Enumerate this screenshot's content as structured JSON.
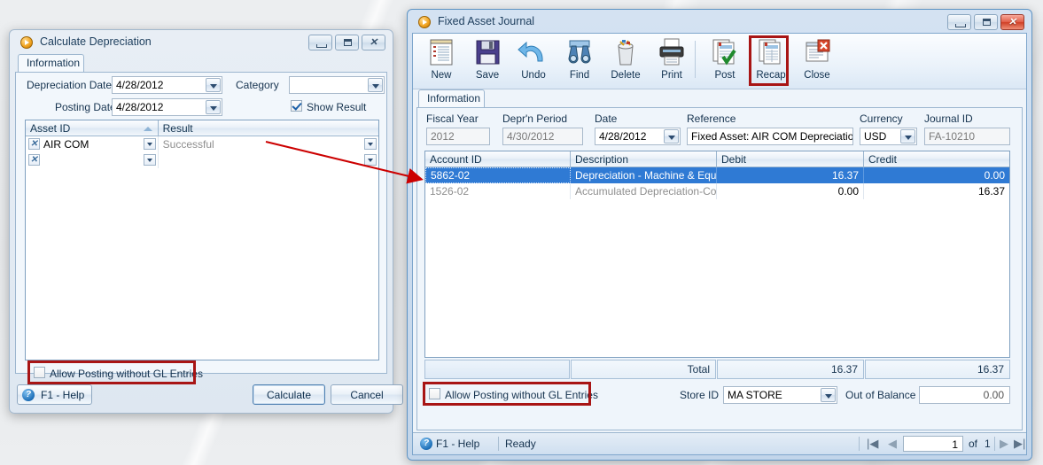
{
  "desktop": {
    "bg": "#e9eaec"
  },
  "annotation": {
    "color": "#cc0000",
    "highlight_color": "#a81515"
  },
  "left_window": {
    "title": "Calculate Depreciation",
    "icon": "app-orb-icon",
    "titlebar_buttons": [
      {
        "name": "minimize",
        "glyph": "minimize-icon"
      },
      {
        "name": "maximize",
        "glyph": "maximize-icon"
      },
      {
        "name": "close",
        "glyph": "close-icon"
      }
    ],
    "tab": {
      "label": "Information"
    },
    "fields": {
      "depreciation_date_label": "Depreciation Date",
      "depreciation_date_value": "4/28/2012",
      "posting_date_label": "Posting Date",
      "posting_date_value": "4/28/2012",
      "category_label": "Category",
      "category_value": "",
      "show_result_label": "Show Result",
      "show_result_checked": true
    },
    "grid": {
      "columns": [
        "Asset ID",
        "Result"
      ],
      "sorted_column": "Asset ID",
      "sort_direction": "asc",
      "rows": [
        {
          "asset_id": "AIR COM",
          "result": "Successful"
        },
        {
          "asset_id": "",
          "result": ""
        }
      ]
    },
    "allow_posting": {
      "label": "Allow Posting without GL Entries",
      "checked": false,
      "highlighted": true
    },
    "footer": {
      "help_label": "F1 - Help",
      "calculate_label": "Calculate",
      "calculate_accel": "C",
      "cancel_label": "Cancel"
    }
  },
  "right_window": {
    "title": "Fixed Asset Journal",
    "icon": "app-orb-icon",
    "titlebar_buttons": [
      {
        "name": "minimize",
        "glyph": "minimize-icon"
      },
      {
        "name": "maximize",
        "glyph": "maximize-icon"
      },
      {
        "name": "close",
        "glyph": "close-icon",
        "active": true
      }
    ],
    "toolbar": [
      {
        "label": "New",
        "icon": "new-document-icon"
      },
      {
        "label": "Save",
        "icon": "floppy-disk-icon"
      },
      {
        "label": "Undo",
        "icon": "undo-arrow-icon"
      },
      {
        "label": "Find",
        "icon": "binoculars-icon"
      },
      {
        "label": "Delete",
        "icon": "trash-can-icon"
      },
      {
        "label": "Print",
        "icon": "printer-icon"
      },
      {
        "label": "Post",
        "icon": "pages-check-icon"
      },
      {
        "label": "Recap",
        "icon": "pages-icon",
        "highlighted": true
      },
      {
        "label": "Close",
        "icon": "window-close-icon"
      }
    ],
    "tab": {
      "label": "Information"
    },
    "fields": {
      "fiscal_year_label": "Fiscal Year",
      "fiscal_year_value": "2012",
      "depr_period_label": "Depr'n Period",
      "depr_period_value": "4/30/2012",
      "date_label": "Date",
      "date_value": "4/28/2012",
      "reference_label": "Reference",
      "reference_value": "Fixed Asset: AIR COM Depreciation",
      "currency_label": "Currency",
      "currency_value": "USD",
      "journal_id_label": "Journal ID",
      "journal_id_value": "FA-10210"
    },
    "grid": {
      "columns": [
        "Account ID",
        "Description",
        "Debit",
        "Credit"
      ],
      "rows": [
        {
          "account_id": "5862-02",
          "description": "Depreciation - Machine & Equi...",
          "debit": "16.37",
          "credit": "0.00",
          "selected": true
        },
        {
          "account_id": "1526-02",
          "description": "Accumulated Depreciation-Cor...",
          "debit": "0.00",
          "credit": "16.37",
          "selected": false
        }
      ],
      "total_label": "Total",
      "total_debit": "16.37",
      "total_credit": "16.37"
    },
    "allow_posting": {
      "label": "Allow Posting without GL Entries",
      "checked": false,
      "highlighted": true
    },
    "bottom": {
      "store_id_label": "Store ID",
      "store_id_value": "MA STORE",
      "out_of_balance_label": "Out of Balance",
      "out_of_balance_value": "0.00"
    },
    "statusbar": {
      "help_label": "F1 - Help",
      "status_text": "Ready",
      "record_current": "1",
      "record_of_label": "of",
      "record_total": "1",
      "nav_first": "first-record-icon",
      "nav_prev": "previous-record-icon",
      "nav_next": "next-record-icon",
      "nav_last": "last-record-icon"
    }
  }
}
